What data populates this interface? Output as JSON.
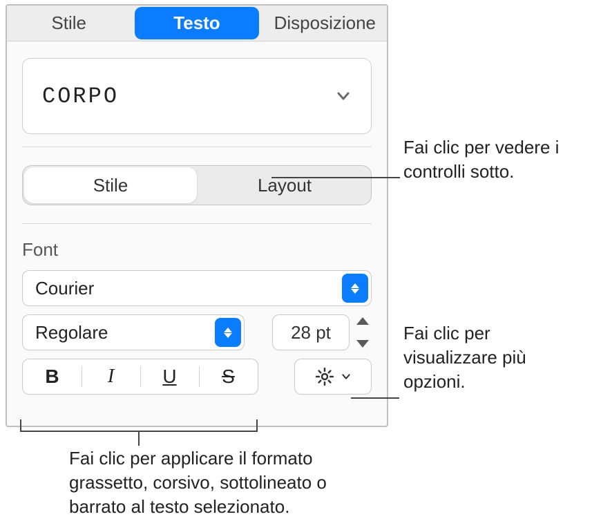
{
  "tabs": {
    "stile": "Stile",
    "testo": "Testo",
    "disposizione": "Disposizione"
  },
  "paragraphStyle": {
    "current": "CORPO"
  },
  "subTabs": {
    "stile": "Stile",
    "layout": "Layout"
  },
  "fontSection": {
    "label": "Font",
    "family": "Courier",
    "typeface": "Regolare",
    "size": "28 pt"
  },
  "formatButtons": {
    "bold": "B",
    "italic": "I",
    "underline": "U",
    "strike": "S"
  },
  "callouts": {
    "c1": "Fai clic per vedere i controlli sotto.",
    "c2": "Fai clic per visualizzare più opzioni.",
    "c3": "Fai clic per applicare il formato grassetto, corsivo, sottolineato o barrato al testo selezionato."
  }
}
